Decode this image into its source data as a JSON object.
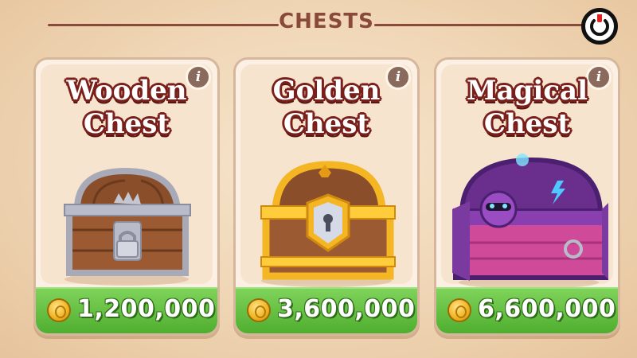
{
  "header": {
    "title": "CHESTS"
  },
  "cards": [
    {
      "title_line1": "Wooden",
      "title_line2": "Chest",
      "price": "1,200,000",
      "info": "i"
    },
    {
      "title_line1": "Golden",
      "title_line2": "Chest",
      "price": "3,600,000",
      "info": "i"
    },
    {
      "title_line1": "Magical",
      "title_line2": "Chest",
      "price": "6,600,000",
      "info": "i"
    }
  ],
  "colors": {
    "background": "#efd5b4",
    "title_outline": "#7a1f1a",
    "price_bar": "#4fae2f",
    "wooden_trim": "#a8aab8",
    "golden_trim": "#f4b622",
    "magical_body": "#8a3fb0"
  },
  "icons": [
    "power-icon",
    "info-icon",
    "coin-icon",
    "lock-icon"
  ]
}
